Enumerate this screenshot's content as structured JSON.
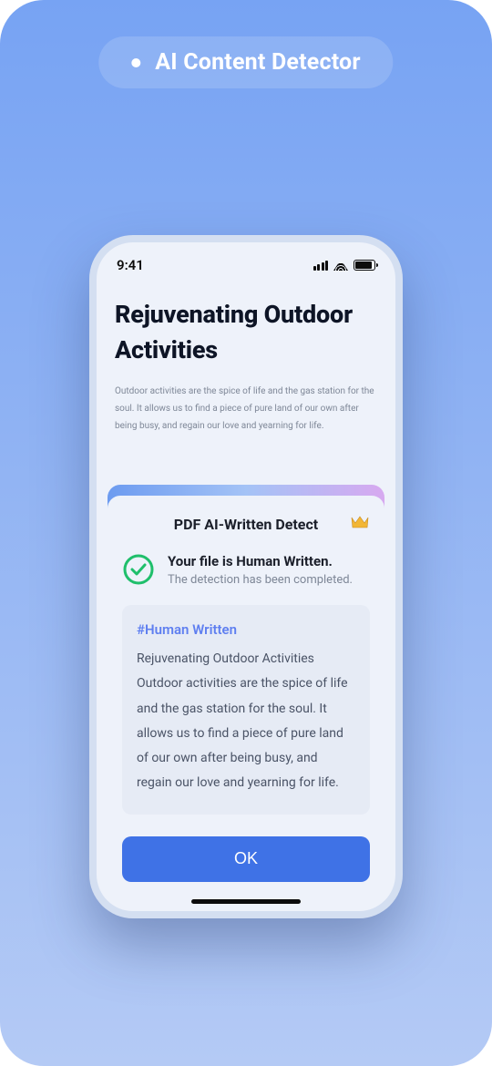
{
  "badge": {
    "label": "AI Content Detector"
  },
  "statusbar": {
    "time": "9:41"
  },
  "document": {
    "title": "Rejuvenating Outdoor Activities",
    "body": "Outdoor activities are the spice of life and the gas station for the soul. It allows us to find a piece of pure land of our own after being busy, and regain our love and yearning for life."
  },
  "sheet": {
    "title": "PDF AI-Written Detect",
    "result_heading": "Your file is Human Written.",
    "result_sub": "The detection has been completed.",
    "tag": "#Human Written",
    "excerpt": "Rejuvenating Outdoor Activities Outdoor activities are the spice of life and the gas station for the soul. It allows us to find a piece of pure land of our own after being busy, and regain our love and yearning for life.",
    "ok_label": "OK"
  },
  "colors": {
    "accent": "#3f72e6",
    "success": "#1fbf6b",
    "premium": "#f2b635"
  }
}
